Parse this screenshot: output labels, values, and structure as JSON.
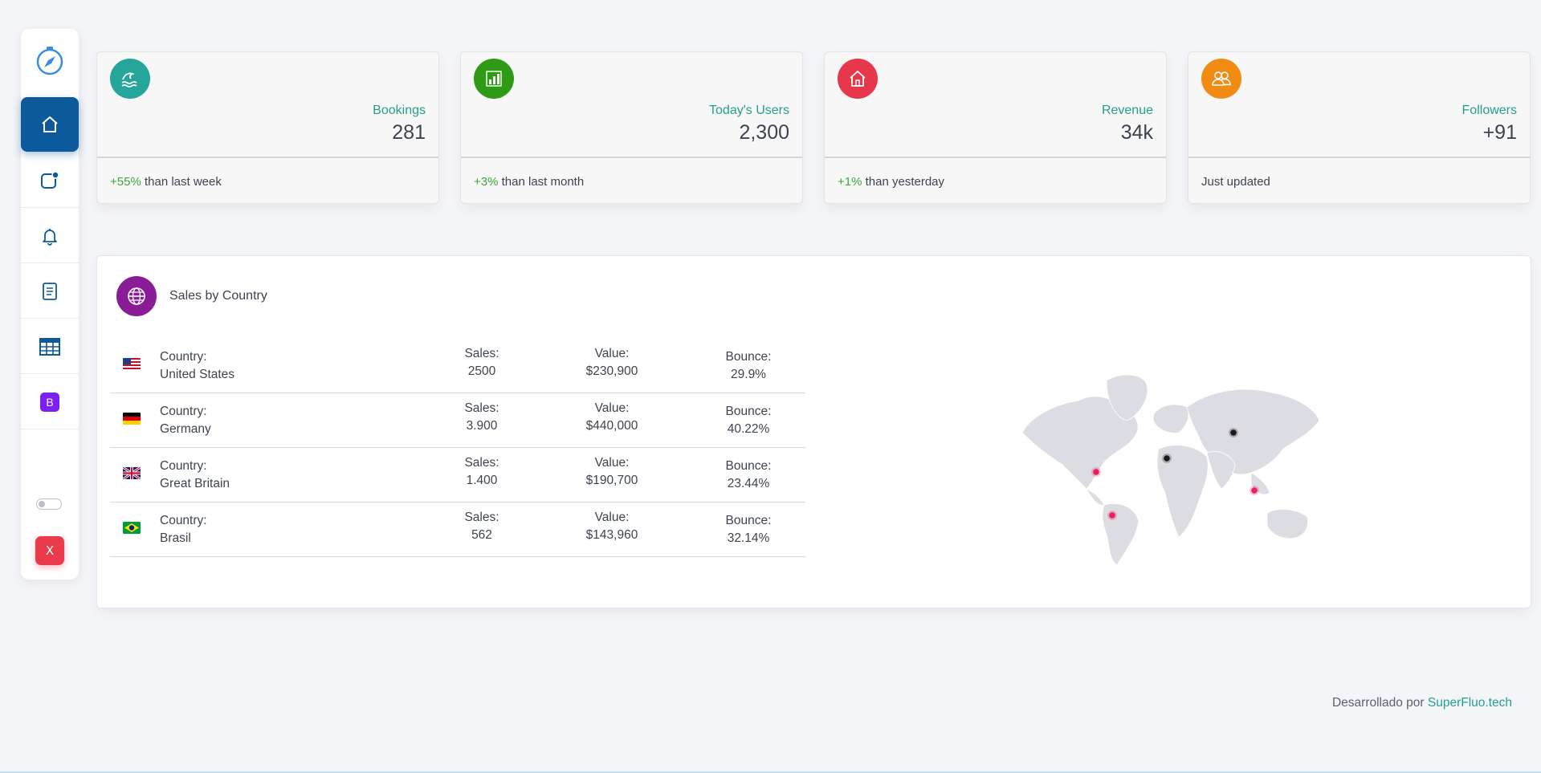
{
  "sidebar": {
    "items": [
      {
        "icon": "home-icon"
      },
      {
        "icon": "notifications-app-icon"
      },
      {
        "icon": "bell-icon"
      },
      {
        "icon": "document-icon"
      },
      {
        "icon": "table-icon"
      },
      {
        "icon": "bootstrap-icon",
        "label": "B"
      }
    ],
    "exit_label": "X"
  },
  "cards": [
    {
      "label": "Bookings",
      "value": "281",
      "pct": "+55%",
      "foot": " than last week",
      "color": "#26a69a",
      "icon": "wave-icon"
    },
    {
      "label": "Today's Users",
      "value": "2,300",
      "pct": "+3%",
      "foot": " than last month",
      "color": "#2f9a15",
      "icon": "bar-chart-icon"
    },
    {
      "label": "Revenue",
      "value": "34k",
      "pct": "+1%",
      "foot": " than yesterday",
      "color": "#e7374a",
      "icon": "house-icon"
    },
    {
      "label": "Followers",
      "value": "+91",
      "pct": "",
      "foot": "Just updated",
      "color": "#f08c12",
      "icon": "people-icon"
    }
  ],
  "sales": {
    "title": "Sales by Country",
    "rows": [
      {
        "country_label": "Country:",
        "country": "United States",
        "sales_label": "Sales:",
        "sales": "2500",
        "value_label": "Value:",
        "value": "$230,900",
        "bounce_label": "Bounce:",
        "bounce": "29.9%",
        "flag": "us"
      },
      {
        "country_label": "Country:",
        "country": "Germany",
        "sales_label": "Sales:",
        "sales": "3.900",
        "value_label": "Value:",
        "value": "$440,000",
        "bounce_label": "Bounce:",
        "bounce": "40.22%",
        "flag": "de"
      },
      {
        "country_label": "Country:",
        "country": "Great Britain",
        "sales_label": "Sales:",
        "sales": "1.400",
        "value_label": "Value:",
        "value": "$190,700",
        "bounce_label": "Bounce:",
        "bounce": "23.44%",
        "flag": "gb"
      },
      {
        "country_label": "Country:",
        "country": "Brasil",
        "sales_label": "Sales:",
        "sales": "562",
        "value_label": "Value:",
        "value": "$143,960",
        "bounce_label": "Bounce:",
        "bounce": "32.14%",
        "flag": "br"
      }
    ]
  },
  "footer": {
    "text": "Desarrollado por ",
    "link": "SuperFluo.tech"
  },
  "colors": {
    "accent": "#24a08b",
    "active_nav": "#0c5a9c",
    "exit": "#ea3b4d",
    "positive": "#3aa839",
    "marker_pink": "#e91e63",
    "marker_dark": "#1a1a1a"
  }
}
